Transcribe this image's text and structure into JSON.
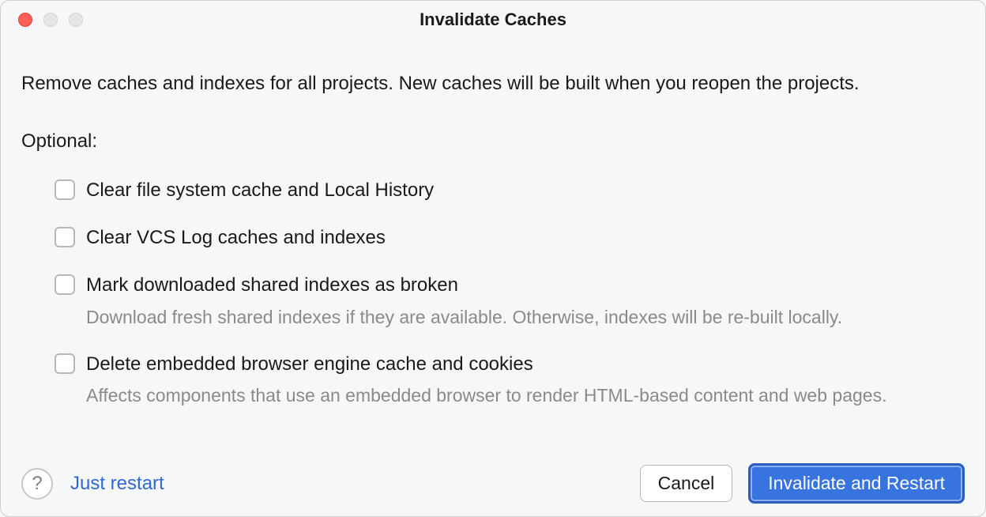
{
  "dialog": {
    "title": "Invalidate Caches",
    "description": "Remove caches and indexes for all projects. New caches will be built when you reopen the projects.",
    "optional_label": "Optional:",
    "options": [
      {
        "label": "Clear file system cache and Local History",
        "description": "",
        "checked": false
      },
      {
        "label": "Clear VCS Log caches and indexes",
        "description": "",
        "checked": false
      },
      {
        "label": "Mark downloaded shared indexes as broken",
        "description": "Download fresh shared indexes if they are available. Otherwise, indexes will be re-built locally.",
        "checked": false
      },
      {
        "label": "Delete embedded browser engine cache and cookies",
        "description": "Affects components that use an embedded browser to render HTML-based content and web pages.",
        "checked": false
      }
    ],
    "footer": {
      "help_icon": "?",
      "just_restart": "Just restart",
      "cancel": "Cancel",
      "invalidate_restart": "Invalidate and Restart"
    }
  }
}
